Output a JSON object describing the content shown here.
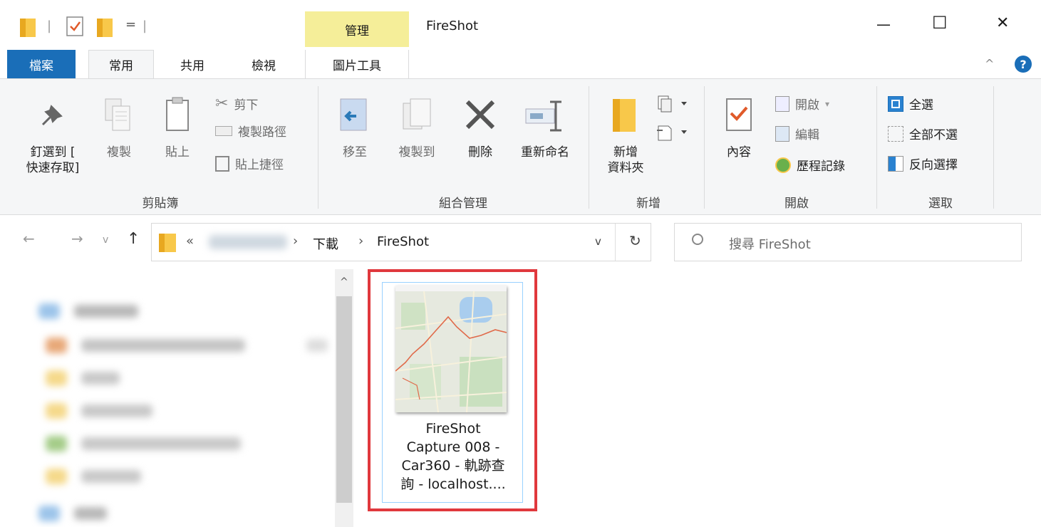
{
  "titlebar": {
    "quick_sep": "|",
    "quick_dropdown": "=",
    "context_tab": "管理",
    "title": "FireShot",
    "minimize": "—",
    "maximize": "☐",
    "close": "✕",
    "context_color": "#f5ee99"
  },
  "tabs": {
    "file": "檔案",
    "home": "常用",
    "share": "共用",
    "view": "檢視",
    "picture_tools": "圖片工具",
    "collapse": "^",
    "help": "?",
    "file_color": "#1a6eb8"
  },
  "ribbon": {
    "clipboard": {
      "pin_line1": "釘選到 [",
      "pin_line2": "快速存取]",
      "copy": "複製",
      "paste": "貼上",
      "cut": "剪下",
      "copy_path": "複製路徑",
      "paste_shortcut": "貼上捷徑",
      "group": "剪貼簿"
    },
    "organize": {
      "move_to": "移至",
      "copy_to": "複製到",
      "delete": "刪除",
      "rename": "重新命名",
      "group": "組合管理"
    },
    "new": {
      "new_folder_line1": "新增",
      "new_folder_line2": "資料夾",
      "group": "新增"
    },
    "open": {
      "properties": "內容",
      "open": "開啟",
      "edit": "編輯",
      "history": "歷程記錄",
      "group": "開啟"
    },
    "select": {
      "select_all": "全選",
      "select_none": "全部不選",
      "invert": "反向選擇",
      "group": "選取"
    }
  },
  "address": {
    "back": "←",
    "forward": "→",
    "recent": "v",
    "up": "↑",
    "overflow": "«",
    "sep": "›",
    "crumb_downloads": "下載",
    "crumb_fireshot": "FireShot",
    "dropdown": "v",
    "refresh": "↻",
    "search_placeholder": "搜尋 FireShot"
  },
  "content": {
    "scroll_up": "^",
    "file": {
      "name_line1": "FireShot",
      "name_line2": "Capture 008 -",
      "name_line3": "Car360 - 軌跡查",
      "name_line4": "詢 - localhost...."
    },
    "highlight_color": "#e0383d"
  }
}
